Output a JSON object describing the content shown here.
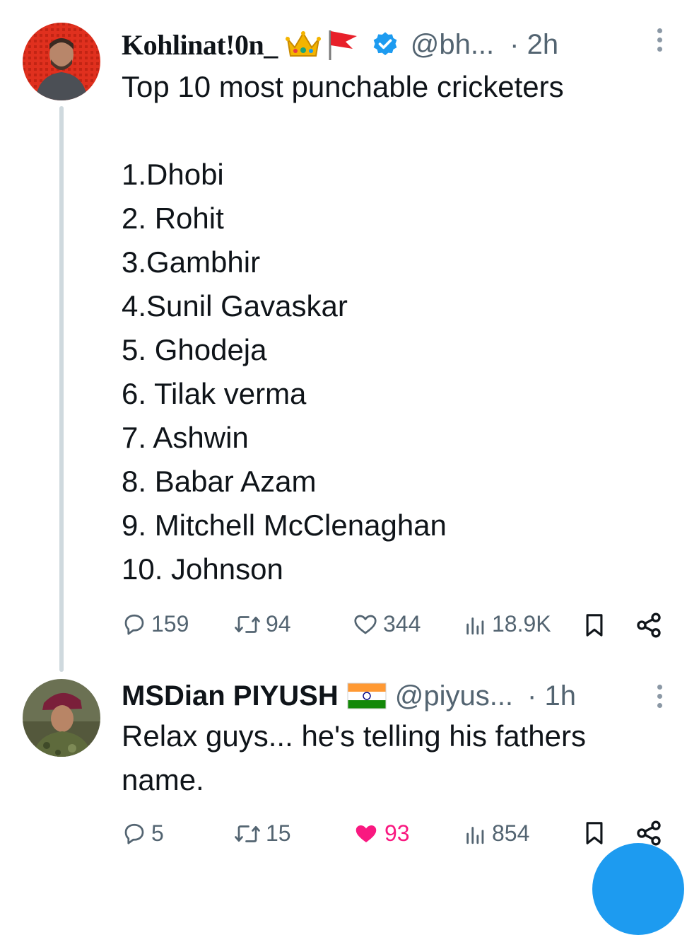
{
  "tweets": [
    {
      "author": {
        "name": "Kohlinat!0n_",
        "name_emoji": "👑🚩",
        "verified": true,
        "handle": "@bh...",
        "time": "· 2h"
      },
      "text": "Top 10 most punchable cricketers\n\n1.Dhobi\n2. Rohit\n3.Gambhir\n4.Sunil Gavaskar\n5. Ghodeja\n6. Tilak verma\n7. Ashwin\n8. Babar Azam\n9. Mitchell McClenaghan\n10. Johnson",
      "stats": {
        "replies": "159",
        "reposts": "94",
        "likes": "344",
        "views": "18.9K"
      },
      "liked": false
    },
    {
      "author": {
        "name": "MSDian PIYUSH",
        "name_emoji": "🇮🇳",
        "verified": false,
        "handle": "@piyus...",
        "time": "· 1h"
      },
      "text": "Relax guys... he's telling his fathers\nname.",
      "stats": {
        "replies": "5",
        "reposts": "15",
        "likes": "93",
        "views": "854"
      },
      "liked": true
    }
  ],
  "colors": {
    "text": "#0f1419",
    "secondary": "#536471",
    "verified": "#1d9bf0",
    "like": "#f91880",
    "thread_line": "#cfd9de"
  },
  "icons": [
    "reply-icon",
    "repost-icon",
    "like-icon",
    "views-icon",
    "bookmark-icon",
    "share-icon",
    "more-icon",
    "verified-badge-icon"
  ]
}
